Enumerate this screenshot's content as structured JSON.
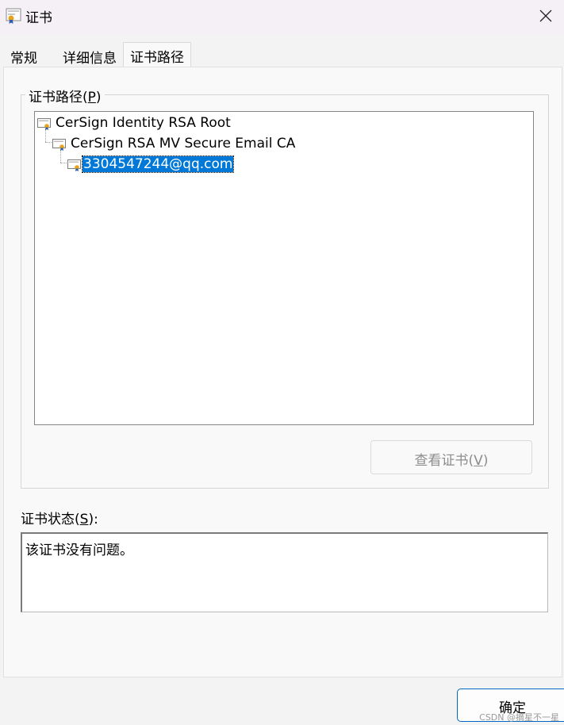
{
  "window": {
    "title": "证书",
    "close_icon": "close-icon"
  },
  "tabs": [
    {
      "label": "常规",
      "active": false
    },
    {
      "label": "详细信息",
      "active": false
    },
    {
      "label": "证书路径",
      "active": true
    }
  ],
  "cert_path": {
    "group_label_prefix": "证书路径(",
    "group_label_key": "P",
    "group_label_suffix": ")",
    "tree": [
      {
        "label": "CerSign Identity RSA Root",
        "level": 0,
        "selected": false
      },
      {
        "label": "CerSign RSA MV Secure Email CA",
        "level": 1,
        "selected": false
      },
      {
        "label": "3304547244@qq.com",
        "level": 2,
        "selected": true
      }
    ],
    "view_button_prefix": "查看证书(",
    "view_button_key": "V",
    "view_button_suffix": ")"
  },
  "status": {
    "label_prefix": "证书状态(",
    "label_key": "S",
    "label_suffix": "):",
    "text": "该证书没有问题。"
  },
  "footer": {
    "ok_label": "确定",
    "watermark": "CSDN @摘星不一星"
  },
  "colors": {
    "selection": "#0078d7",
    "ok_border": "#0067c0"
  }
}
